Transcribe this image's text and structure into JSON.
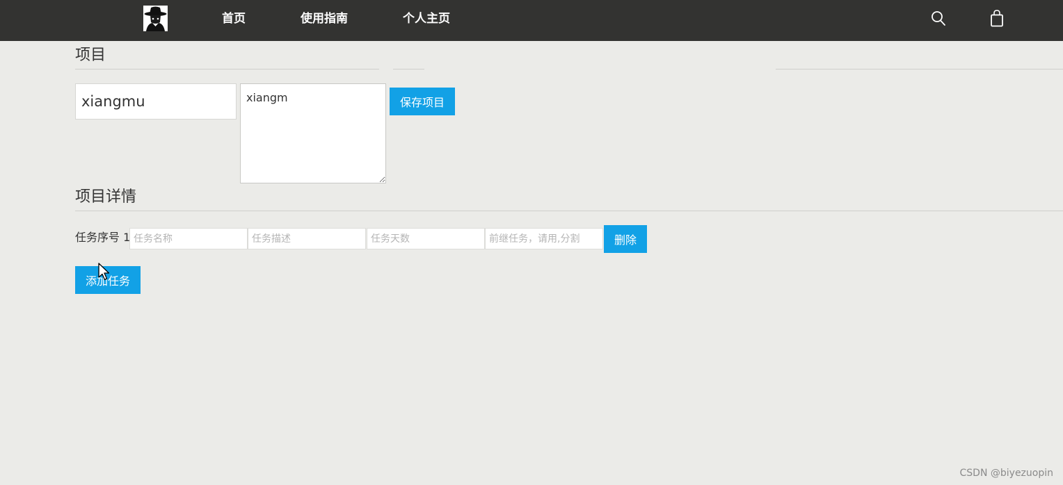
{
  "header": {
    "logo_icon": "masked-figure-avatar-icon",
    "nav": {
      "home": "首页",
      "guide": "使用指南",
      "profile": "个人主页"
    },
    "icons": {
      "search": "search-icon",
      "cart": "shopping-bag-icon"
    },
    "background_color": "#333331"
  },
  "project": {
    "heading": "项目",
    "name_value": "xiangmu",
    "description_value": "xiangm",
    "save_label": "保存项目"
  },
  "details": {
    "heading": "项目详情",
    "tasks": [
      {
        "label": "任务序号 1",
        "name_placeholder": "任务名称",
        "desc_placeholder": "任务描述",
        "days_placeholder": "任务天数",
        "predecessor_placeholder": "前继任务，请用,分割",
        "delete_label": "删除"
      }
    ],
    "add_task_label": "添加任务"
  },
  "watermark": "CSDN @biyezuopin",
  "colors": {
    "accent": "#12a1e6",
    "page_background": "#ebebe8"
  }
}
